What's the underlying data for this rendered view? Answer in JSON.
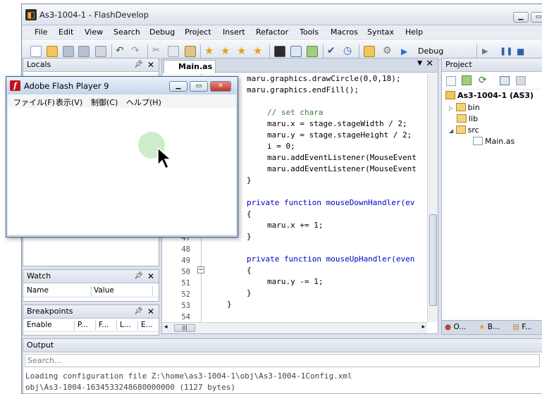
{
  "window": {
    "title": "As3-1004-1 - FlashDevelop",
    "minimize_icon": "minimize-icon",
    "maximize_icon": "maximize-icon"
  },
  "menu": [
    "File",
    "Edit",
    "View",
    "Search",
    "Debug",
    "Project",
    "Insert",
    "Refactor",
    "Tools",
    "Macros",
    "Syntax",
    "Help"
  ],
  "toolbar": {
    "configuration": "Debug"
  },
  "locals_panel": {
    "title": "Locals"
  },
  "watch_panel": {
    "title": "Watch",
    "columns": [
      "Name",
      "Value"
    ]
  },
  "breakpoints_panel": {
    "title": "Breakpoints",
    "columns": [
      "Enable",
      "P...",
      "F...",
      "L...",
      "E..."
    ]
  },
  "editor": {
    "tab": "Main.as",
    "line_numbers": [
      "47",
      "48",
      "49",
      "50",
      "51",
      "52",
      "53",
      "54"
    ],
    "lines": [
      [
        "            ",
        "maru.graphics.drawCircle(0,0,18);"
      ],
      [
        "            ",
        "maru.graphics.endFill();"
      ],
      [
        "",
        ""
      ],
      [
        "            ",
        "// set chara"
      ],
      [
        "            ",
        "maru.x = stage.stageWidth / 2;"
      ],
      [
        "            ",
        "maru.y = stage.stageHeight / 2;"
      ],
      [
        "            ",
        "i = 0;"
      ],
      [
        "            ",
        "maru.addEventListener(MouseEvent"
      ],
      [
        "            ",
        "maru.addEventListener(MouseEvent"
      ],
      [
        "        ",
        "}"
      ],
      [
        "",
        ""
      ],
      [
        "        ",
        "private function mouseDownHandler(ev"
      ],
      [
        "        ",
        "{"
      ],
      [
        "            ",
        "maru.x += 1;"
      ],
      [
        "        ",
        "}"
      ],
      [
        "",
        ""
      ],
      [
        "        ",
        "private function mouseUpHandler(even"
      ],
      [
        "        ",
        "{"
      ],
      [
        "            ",
        "maru.y -= 1;"
      ],
      [
        "        ",
        "}"
      ],
      [
        "    ",
        "}"
      ]
    ]
  },
  "project_panel": {
    "title": "Project",
    "root": "As3-1004-1 (AS3)",
    "folders": [
      "bin",
      "lib",
      "src"
    ],
    "file": "Main.as",
    "footer_tabs": [
      "O...",
      "B...",
      "F..."
    ]
  },
  "output_panel": {
    "title": "Output",
    "search_placeholder": "Search...",
    "lines": [
      "Loading configuration file Z:\\home\\as3-1004-1\\obj\\As3-1004-1Config.xml",
      "obj\\As3-1004-1634533248680000000 (1127 bytes)"
    ]
  },
  "flash_player": {
    "title": "Adobe Flash Player 9",
    "menu": [
      "ファイル(F)",
      "表示(V)",
      "制御(C)",
      "ヘルプ(H)"
    ],
    "ball_color": "#cceccc"
  }
}
